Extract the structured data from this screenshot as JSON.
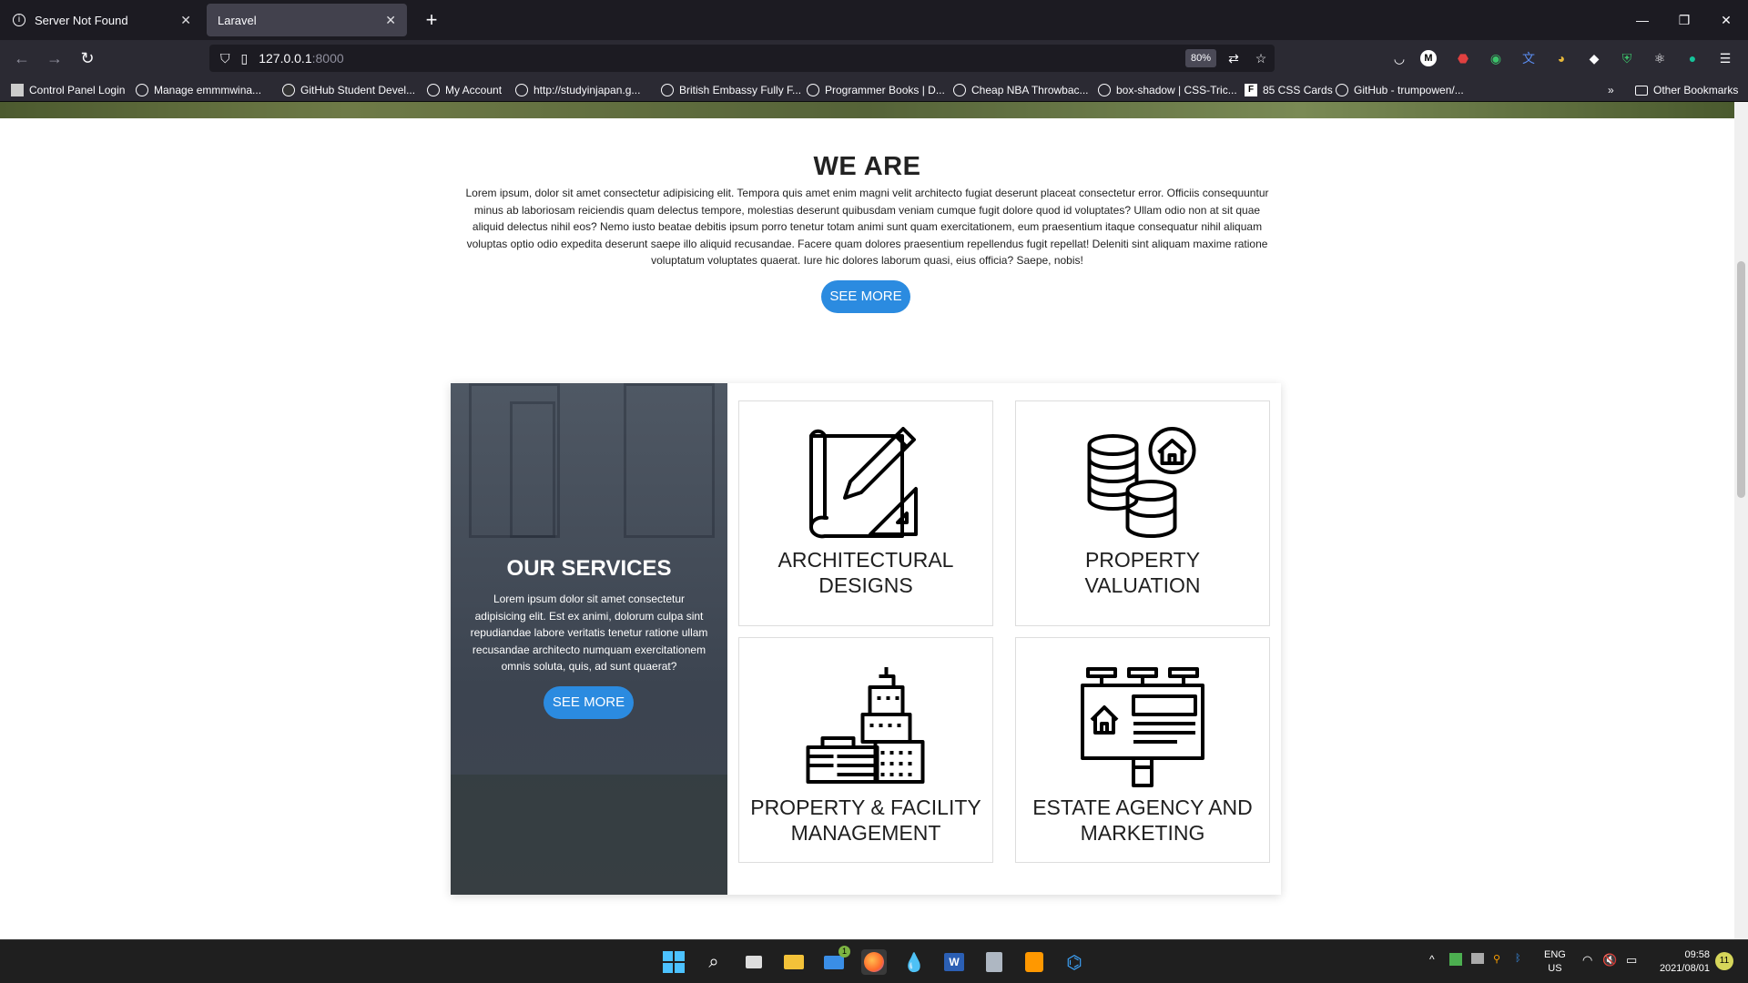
{
  "browser": {
    "tabs": [
      {
        "label": "Server Not Found"
      },
      {
        "label": "Laravel"
      }
    ],
    "url_host": "127.0.0.1",
    "url_port": ":8000",
    "zoom": "80%",
    "bookmarks": [
      "Control Panel Login",
      "Manage emmmwina...",
      "GitHub Student Devel...",
      "My Account",
      "http://studyinjapan.g...",
      "British Embassy Fully F...",
      "Programmer Books | D...",
      "Cheap NBA Throwbac...",
      "box-shadow | CSS-Tric...",
      "85 CSS Cards",
      "GitHub - trumpowen/..."
    ],
    "other_bookmarks": "Other Bookmarks"
  },
  "we_are": {
    "title": "WE ARE",
    "text": "Lorem ipsum, dolor sit amet consectetur adipisicing elit. Tempora quis amet enim magni velit architecto fugiat deserunt placeat consectetur error. Officiis consequuntur minus ab laboriosam reiciendis quam delectus tempore, molestias deserunt quibusdam veniam cumque fugit dolore quod id voluptates? Ullam odio non at sit quae aliquid delectus nihil eos? Nemo iusto beatae debitis ipsum porro tenetur totam animi sunt quam exercitationem, eum praesentium itaque consequatur nihil aliquam voluptas optio odio expedita deserunt saepe illo aliquid recusandae. Facere quam dolores praesentium repellendus fugit repellat! Deleniti sint aliquam maxime ratione voluptatum voluptates quaerat. Iure hic dolores laborum quasi, eius officia? Saepe, nobis!",
    "button": "SEE MORE"
  },
  "services": {
    "title": "OUR SERVICES",
    "text": "Lorem ipsum dolor sit amet consectetur adipisicing elit. Est ex animi, dolorum culpa sint repudiandae labore veritatis tenetur ratione ullam recusandae architecto numquam exercitationem omnis soluta, quis, ad sunt quaerat?",
    "button": "SEE MORE",
    "cards": [
      {
        "line1": "ARCHITECTURAL",
        "line2": "DESIGNS",
        "icon": "blueprint-pencil-icon"
      },
      {
        "line1": "PROPERTY",
        "line2": "VALUATION",
        "icon": "coins-house-icon"
      },
      {
        "line1": "PROPERTY & FACILITY",
        "line2": "MANAGEMENT",
        "icon": "buildings-icon"
      },
      {
        "line1": "ESTATE AGENCY AND",
        "line2": "MARKETING",
        "icon": "billboard-house-icon"
      }
    ]
  },
  "taskbar": {
    "lang1": "ENG",
    "lang2": "US",
    "time": "09:58",
    "date": "2021/08/01",
    "notif": "11",
    "mail_badge": "1"
  }
}
